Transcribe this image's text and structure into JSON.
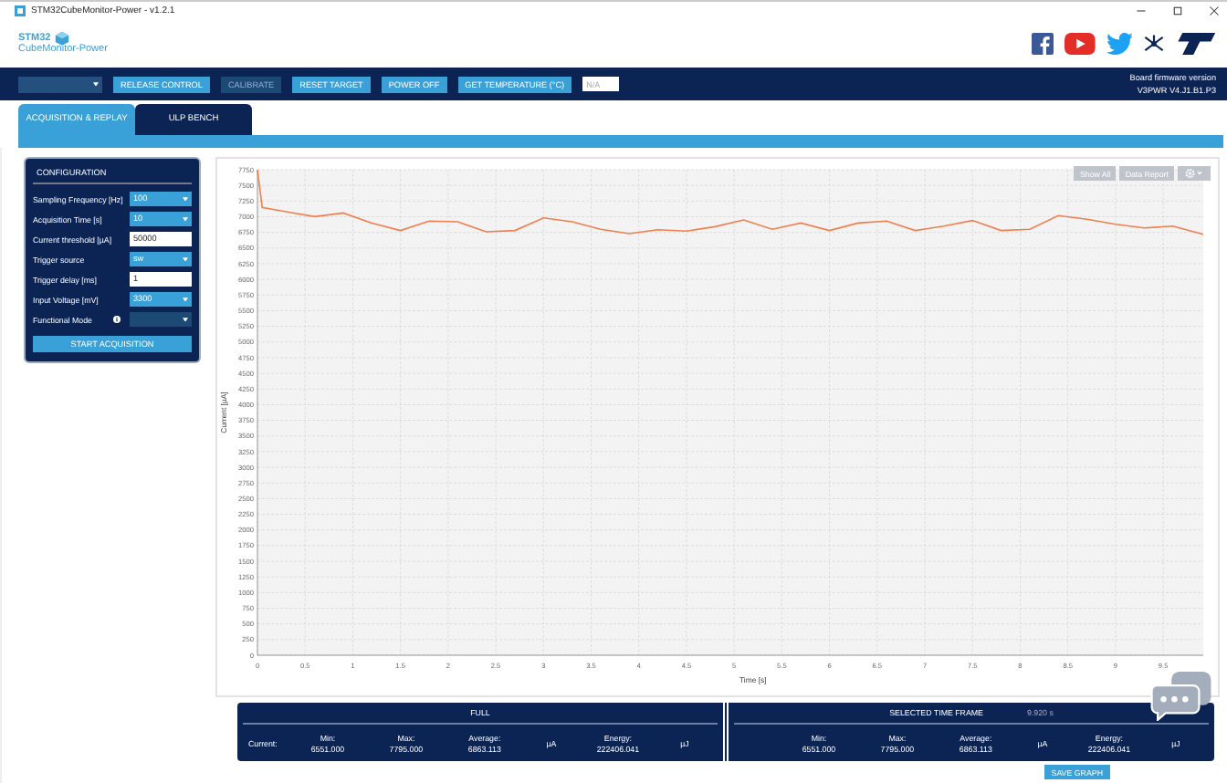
{
  "window": {
    "title": "STM32CubeMonitor-Power - v1.2.1"
  },
  "logo": {
    "line1": "STM32",
    "line2": "CubeMonitor-Power"
  },
  "toolbar": {
    "port_select": {
      "disabled": true
    },
    "buttons": [
      {
        "label": "RELEASE CONTROL",
        "disabled": false
      },
      {
        "label": "CALIBRATE",
        "disabled": true
      },
      {
        "label": "RESET TARGET",
        "disabled": false
      },
      {
        "label": "POWER OFF",
        "disabled": false
      },
      {
        "label": "GET TEMPERATURE (°C)",
        "disabled": false
      }
    ],
    "temperature": {
      "placeholder": "N/A"
    },
    "firmware_label": "Board firmware version",
    "firmware_version": "V3PWR V4.J1.B1.P3"
  },
  "tabs": [
    {
      "label": "ACQUISITION & REPLAY",
      "selected": true
    },
    {
      "label": "ULP BENCH",
      "selected": false
    }
  ],
  "configuration": {
    "title": "CONFIGURATION",
    "fields": [
      {
        "label": "Sampling Frequency [Hz]",
        "kind": "select",
        "value": "100",
        "disabled": false
      },
      {
        "label": "Acquisition Time [s]",
        "kind": "select",
        "value": "10",
        "disabled": false
      },
      {
        "label": "Current threshold [µA]",
        "kind": "input",
        "value": "50000",
        "disabled": false
      },
      {
        "label": "Trigger source",
        "kind": "select",
        "value": "sw",
        "disabled": false
      },
      {
        "label": "Trigger delay [ms]",
        "kind": "input",
        "value": "1",
        "disabled": false
      },
      {
        "label": "Input Voltage [mV]",
        "kind": "select",
        "value": "3300",
        "disabled": false
      },
      {
        "label": "Functional Mode",
        "kind": "select-info",
        "disabled": true
      }
    ],
    "start_button": "START ACQUISITION"
  },
  "chart_toolbar": {
    "buttons": [
      "Show All",
      "Data Report"
    ]
  },
  "chart": {
    "chart_data": {
      "type": "line",
      "grid": true,
      "xlabel": "Time [s]",
      "ylabel": "Current [µA]",
      "xlim": [
        0,
        9.92
      ],
      "ylim": [
        0,
        7750
      ],
      "xticks": [
        0,
        0.5,
        1,
        1.5,
        2,
        2.5,
        3,
        3.5,
        4,
        4.5,
        5,
        5.5,
        6,
        6.5,
        7,
        7.5,
        8,
        8.5,
        9,
        9.5
      ],
      "yticks": [
        0,
        250,
        500,
        750,
        1000,
        1250,
        1500,
        1750,
        2000,
        2250,
        2500,
        2750,
        3000,
        3250,
        3500,
        3750,
        4000,
        4250,
        4500,
        4750,
        5000,
        5250,
        5500,
        5750,
        6000,
        6250,
        6500,
        6750,
        7000,
        7250,
        7500,
        7750
      ],
      "x": [
        0,
        0.05,
        0.3,
        0.6,
        0.9,
        1.2,
        1.5,
        1.8,
        2.1,
        2.4,
        2.7,
        3.0,
        3.3,
        3.6,
        3.9,
        4.2,
        4.5,
        4.8,
        5.1,
        5.4,
        5.7,
        6.0,
        6.3,
        6.6,
        6.9,
        7.2,
        7.5,
        7.8,
        8.1,
        8.4,
        8.7,
        9.0,
        9.3,
        9.6,
        9.92
      ],
      "series": [
        {
          "color": "#f07f4f",
          "values": [
            7750,
            7150,
            7080,
            7000,
            7060,
            6900,
            6780,
            6930,
            6920,
            6760,
            6780,
            6980,
            6920,
            6800,
            6730,
            6790,
            6770,
            6840,
            6950,
            6800,
            6900,
            6780,
            6900,
            6930,
            6780,
            6850,
            6940,
            6780,
            6800,
            7020,
            6960,
            6880,
            6820,
            6850,
            6720
          ]
        }
      ]
    }
  },
  "stats": {
    "full": {
      "title": "FULL",
      "row_label": "Current:",
      "cells": [
        {
          "kind": "stat",
          "header": "Min:",
          "value": "6551.000"
        },
        {
          "kind": "stat",
          "header": "Max:",
          "value": "7795.000"
        },
        {
          "kind": "stat",
          "header": "Average:",
          "value": "6863.113"
        },
        {
          "kind": "unit",
          "value": "µA"
        },
        {
          "kind": "stat",
          "header": "Energy:",
          "value": "222406.041"
        },
        {
          "kind": "unit",
          "value": "µJ"
        }
      ]
    },
    "selected": {
      "title": "SELECTED TIME FRAME",
      "duration": "9.920 s",
      "cells": [
        {
          "kind": "stat",
          "header": "Min:",
          "value": "6551.000"
        },
        {
          "kind": "stat",
          "header": "Max:",
          "value": "7795.000"
        },
        {
          "kind": "stat",
          "header": "Average:",
          "value": "6863.113"
        },
        {
          "kind": "unit",
          "value": "µA"
        },
        {
          "kind": "stat",
          "header": "Energy:",
          "value": "222406.041"
        },
        {
          "kind": "unit",
          "value": "µJ"
        }
      ]
    }
  },
  "bottom_buttons": [
    "SAVE GRAPH"
  ]
}
